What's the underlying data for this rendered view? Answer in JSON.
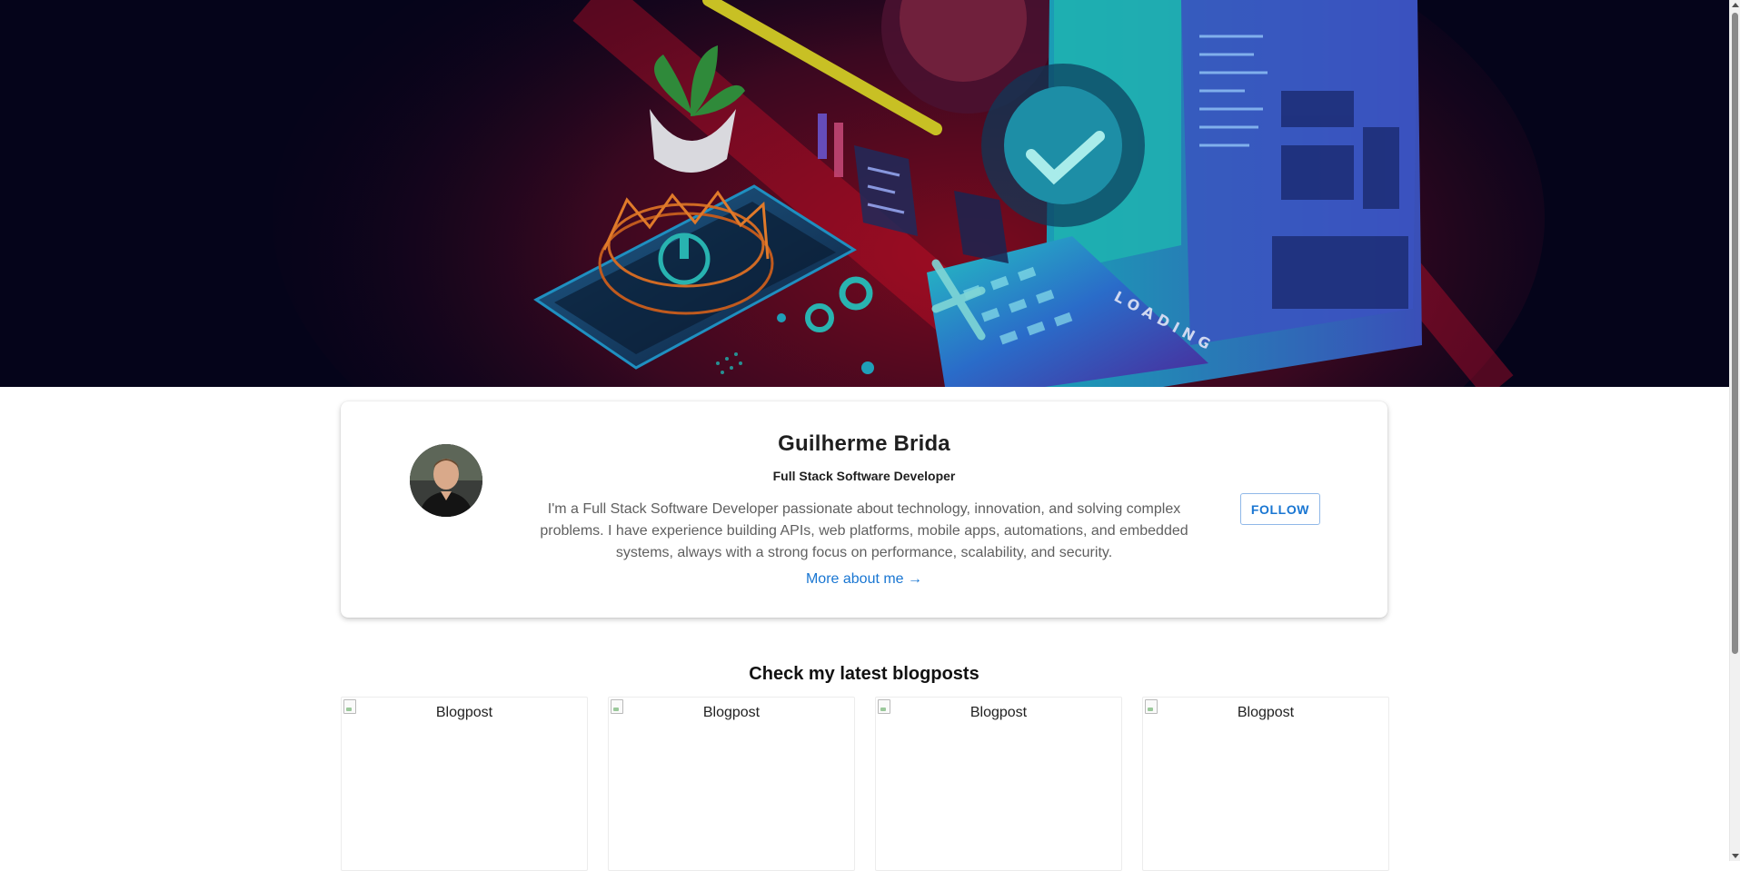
{
  "hero": {
    "banner_text": "LOADING"
  },
  "profile": {
    "name": "Guilherme Brida",
    "role": "Full Stack Software Developer",
    "bio": "I'm a Full Stack Software Developer passionate about technology, innovation, and solving complex problems. I have experience building APIs, web platforms, mobile apps, automations, and embedded systems, always with a strong focus on performance, scalability, and security.",
    "more_link": "More about me →",
    "follow_label": "FOLLOW"
  },
  "blog": {
    "title": "Check my latest blogposts",
    "posts": [
      {
        "alt": "Blogpost"
      },
      {
        "alt": "Blogpost"
      },
      {
        "alt": "Blogpost"
      },
      {
        "alt": "Blogpost"
      }
    ]
  },
  "colors": {
    "accent": "#1976d2",
    "hero_bg": "#05041a",
    "hero_red": "#d01020",
    "hero_teal": "#1fb3b0"
  }
}
